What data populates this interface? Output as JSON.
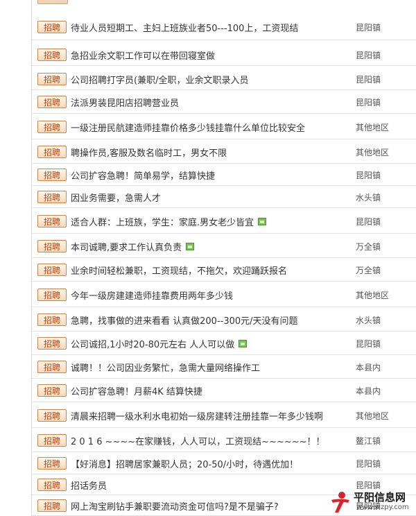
{
  "badge_label": "招聘",
  "colors": {
    "badge_text": "#b54716",
    "badge_border": "#c8854c",
    "row_divider": "#e3e3e3"
  },
  "listings": [
    {
      "title": "待业人员短期工、主妇上班族业者50---100上，工资现结",
      "location": "昆阳镇",
      "has_image": false
    },
    {
      "title": "急招业余文职工作可以在带回寝室做",
      "location": "昆阳镇",
      "has_image": false
    },
    {
      "title": "公司招聘打字员(兼职/全职，业余文职录入员",
      "location": "昆阳镇",
      "has_image": false
    },
    {
      "title": "法派男装昆阳店招聘营业员",
      "location": "昆阳镇",
      "has_image": false
    },
    {
      "title": "一级注册民航建造师挂靠价格多少钱挂靠什么单位比较安全",
      "location": "其他地区",
      "has_image": false
    },
    {
      "title": "聘操作员,客服及数名临时工，男女不限",
      "location": "其他地区",
      "has_image": false
    },
    {
      "title": "公司扩容急聘！简单易学，结算快捷",
      "location": "昆阳镇",
      "has_image": false
    },
    {
      "title": "因业务需要，急需人才",
      "location": "水头镇",
      "has_image": false
    },
    {
      "title": "适合人群：上班族，学生：家庭.男女老少皆宜",
      "location": "昆阳镇",
      "has_image": true
    },
    {
      "title": "本司诚聘,要求工作认真负责",
      "location": "万全镇",
      "has_image": true
    },
    {
      "title": "业余时间轻松兼职，工资现结，不拖欠，欢迎踊跃报名",
      "location": "万全镇",
      "has_image": false
    },
    {
      "title": "今年一级房建建造师挂靠费用两年多少钱",
      "location": "其他地区",
      "has_image": false
    },
    {
      "title": "急聘，找事做的进来看看 认真做200--300元/天没有问题",
      "location": "水头镇",
      "has_image": false
    },
    {
      "title": "公司诚招,1小时20-80元左右 人人可以做",
      "location": "昆阳镇",
      "has_image": true
    },
    {
      "title": "诚聘！！公司因业务繁忙，急需大量网络操作工",
      "location": "本县内",
      "has_image": false
    },
    {
      "title": "公司扩容急聘！月薪4K 结算快捷",
      "location": "本县内",
      "has_image": false
    },
    {
      "title": "清晨来招聘一级水利水电初始一级房建转注册挂靠一年多少钱啊",
      "location": "其他地区",
      "has_image": false
    },
    {
      "title": "2 0 1 6 ~~~~在家赚钱，人人可以，工资现结~~~~~~！！",
      "location": "鳌江镇",
      "has_image": false
    },
    {
      "title": "【好消息】招聘居家兼职人员；20-50/小时，待遇优加！",
      "location": "昆阳镇",
      "has_image": false
    },
    {
      "title": "招话务员",
      "location": "昆阳镇",
      "has_image": false
    },
    {
      "title": "网上淘宝刷钻手兼职要流动资金可信吗?是不是骗子?",
      "location": "昆阳镇",
      "has_image": false
    }
  ],
  "watermark": {
    "name": "平阳信息网",
    "url": "www.wzpy.com"
  }
}
